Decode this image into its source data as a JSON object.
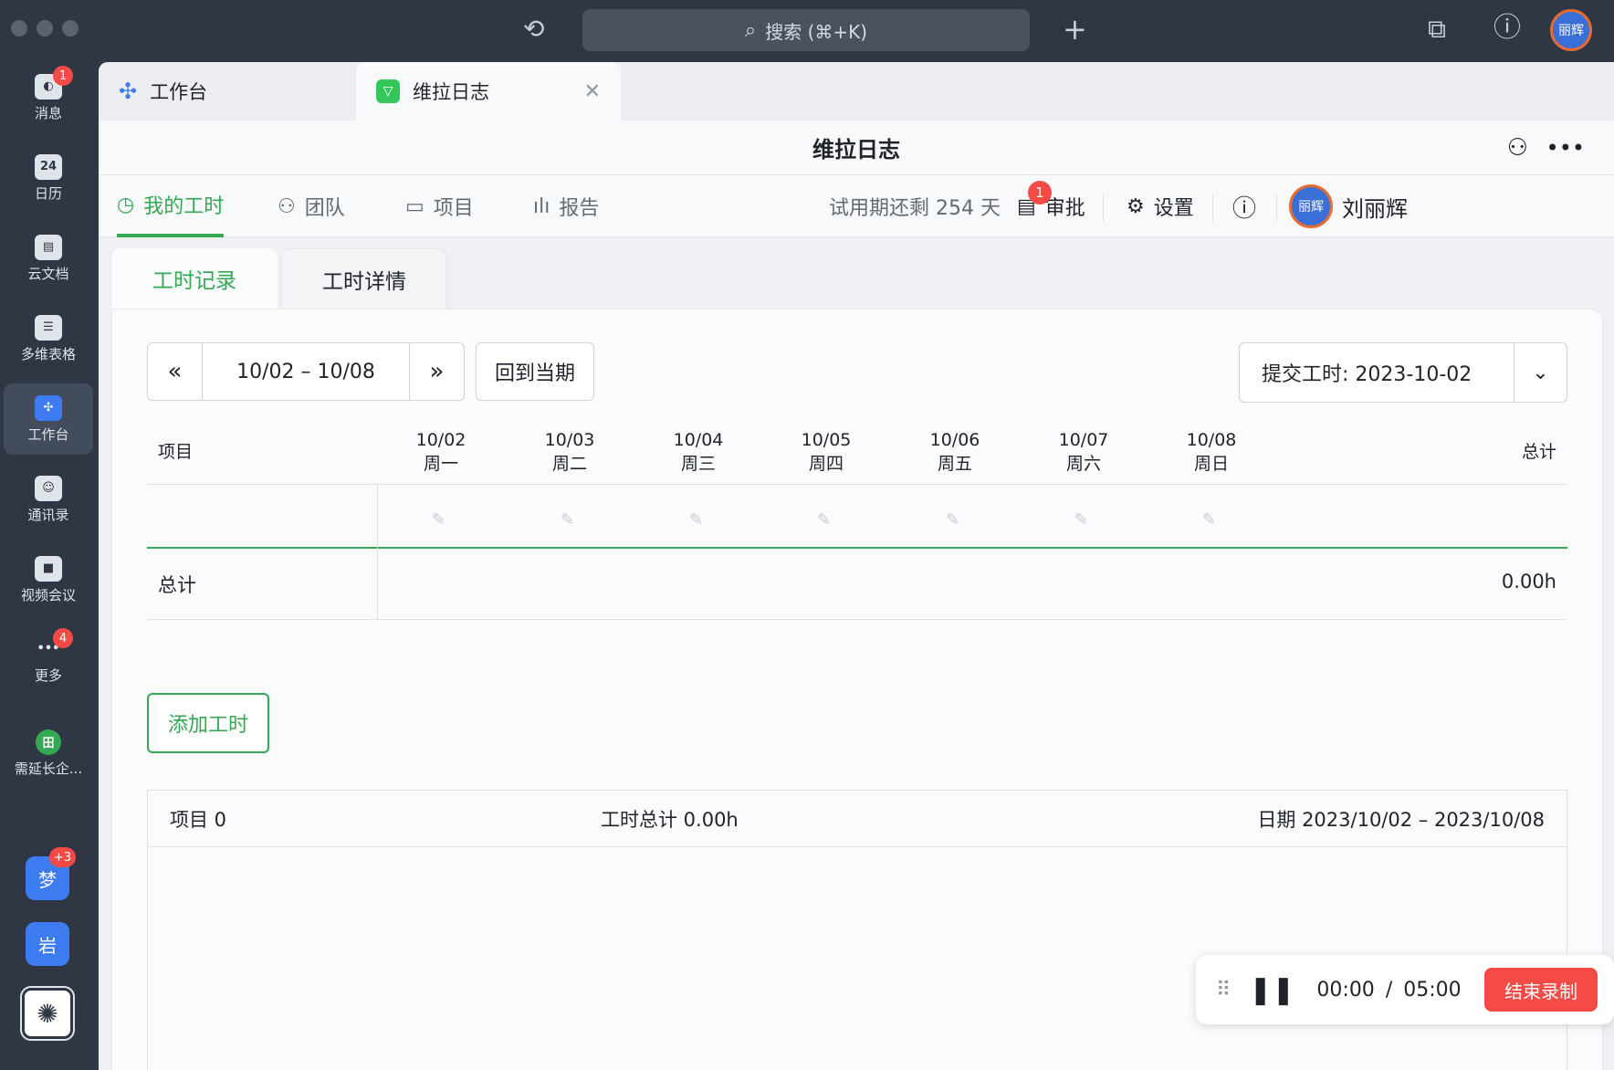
{
  "titlebar": {
    "search_label": "搜索 (⌘+K)",
    "avatar_text": "丽辉"
  },
  "rail": {
    "items": [
      {
        "label": "消息",
        "glyph": "◐",
        "badge": "1"
      },
      {
        "label": "日历",
        "glyph": "24",
        "badge": ""
      },
      {
        "label": "云文档",
        "glyph": "▤",
        "badge": ""
      },
      {
        "label": "多维表格",
        "glyph": "☰",
        "badge": ""
      },
      {
        "label": "工作台",
        "glyph": "✣",
        "badge": ""
      },
      {
        "label": "通讯录",
        "glyph": "☺",
        "badge": ""
      },
      {
        "label": "视频会议",
        "glyph": "■",
        "badge": ""
      },
      {
        "label": "更多",
        "glyph": "•••",
        "badge": "4"
      },
      {
        "label": "需延长企...",
        "glyph": "田",
        "badge": ""
      }
    ],
    "apps": [
      {
        "text": "梦",
        "badge": "+3"
      },
      {
        "text": "岩",
        "badge": ""
      }
    ]
  },
  "tabs": [
    {
      "label": "工作台"
    },
    {
      "label": "维拉日志"
    }
  ],
  "header": {
    "title": "维拉日志"
  },
  "nav": {
    "items": [
      {
        "label": "我的工时"
      },
      {
        "label": "团队"
      },
      {
        "label": "项目"
      },
      {
        "label": "报告"
      }
    ],
    "trial_text": "试用期还剩 254 天",
    "approval_label": "审批",
    "approval_badge": "1",
    "settings_label": "设置",
    "user_avatar": "丽辉",
    "user_name": "刘丽辉"
  },
  "subtabs": [
    {
      "label": "工时记录"
    },
    {
      "label": "工时详情"
    }
  ],
  "toolbar": {
    "prev": "«",
    "range": "10/02 – 10/08",
    "next": "»",
    "current_period": "回到当期",
    "submit_select": "提交工时: 2023-10-02"
  },
  "table": {
    "project_header": "项目",
    "total_header": "总计",
    "days": [
      {
        "date": "10/02",
        "weekday": "周一"
      },
      {
        "date": "10/03",
        "weekday": "周二"
      },
      {
        "date": "10/04",
        "weekday": "周三"
      },
      {
        "date": "10/05",
        "weekday": "周四"
      },
      {
        "date": "10/06",
        "weekday": "周五"
      },
      {
        "date": "10/07",
        "weekday": "周六"
      },
      {
        "date": "10/08",
        "weekday": "周日"
      }
    ],
    "total_row_label": "总计",
    "total_row_value": "0.00h"
  },
  "add_button": "添加工时",
  "summary": {
    "projects": "项目 0",
    "hours": "工时总计 0.00h",
    "dates": "日期 2023/10/02 – 2023/10/08"
  },
  "recorder": {
    "time": "00:00",
    "separator": "/",
    "limit": "05:00",
    "end_label": "结束录制"
  },
  "colors": {
    "accent": "#34a853",
    "badge": "#f54a45",
    "rail": "#2f3744"
  }
}
